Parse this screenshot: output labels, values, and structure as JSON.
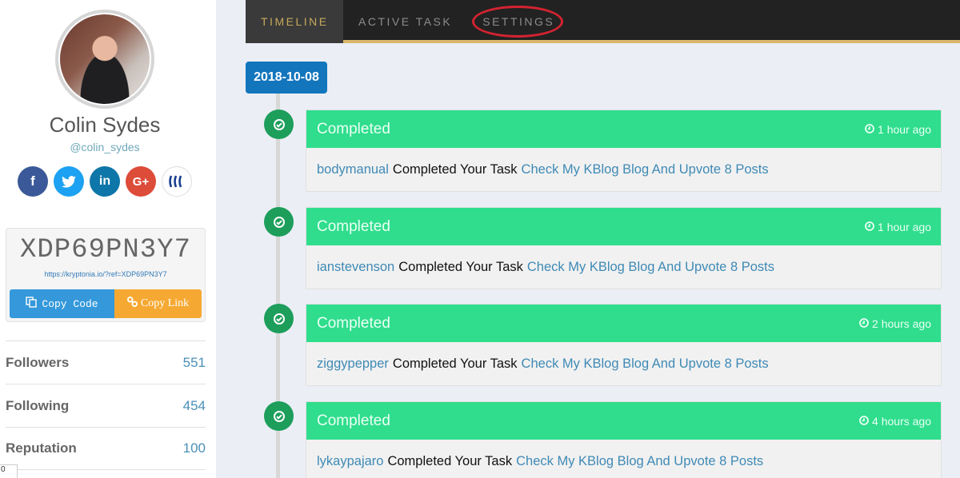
{
  "profile": {
    "name": "Colin Sydes",
    "handle": "@colin_sydes",
    "socials": [
      {
        "name": "facebook",
        "glyph": "f"
      },
      {
        "name": "twitter",
        "glyph": "🐦"
      },
      {
        "name": "linkedin",
        "glyph": "in"
      },
      {
        "name": "google-plus",
        "glyph": "G+"
      },
      {
        "name": "steemit",
        "glyph": "§"
      }
    ]
  },
  "referral": {
    "code": "XDP69PN3Y7",
    "link": "https://kryptonia.io/?ref=XDP69PN3Y7",
    "copy_code_label": "Copy Code",
    "copy_link_label": "Copy Link"
  },
  "stats": [
    {
      "label": "Followers",
      "value": "551"
    },
    {
      "label": "Following",
      "value": "454"
    },
    {
      "label": "Reputation",
      "value": "100"
    }
  ],
  "mini_box": "0",
  "nav": {
    "tabs": [
      {
        "label": "TIMELINE",
        "active": true
      },
      {
        "label": "ACTIVE TASK",
        "active": false
      },
      {
        "label": "SETTINGS",
        "active": false,
        "highlighted": true
      }
    ]
  },
  "timeline": {
    "date": "2018-10-08",
    "entries": [
      {
        "status": "Completed",
        "time": "1 hour ago",
        "user": "bodymanual",
        "action": "Completed Your Task",
        "task": "Check My KBlog Blog And Upvote 8 Posts"
      },
      {
        "status": "Completed",
        "time": "1 hour ago",
        "user": "ianstevenson",
        "action": "Completed Your Task",
        "task": "Check My KBlog Blog And Upvote 8 Posts"
      },
      {
        "status": "Completed",
        "time": "2 hours ago",
        "user": "ziggypepper",
        "action": "Completed Your Task",
        "task": "Check My KBlog Blog And Upvote 8 Posts"
      },
      {
        "status": "Completed",
        "time": "4 hours ago",
        "user": "lykaypajaro",
        "action": "Completed Your Task",
        "task": "Check My KBlog Blog And Upvote 8 Posts"
      }
    ]
  },
  "colors": {
    "accent_gold": "#d9b76a",
    "completed_green": "#2fdd8d",
    "date_blue": "#1376bd",
    "highlight_red": "#d42330"
  }
}
